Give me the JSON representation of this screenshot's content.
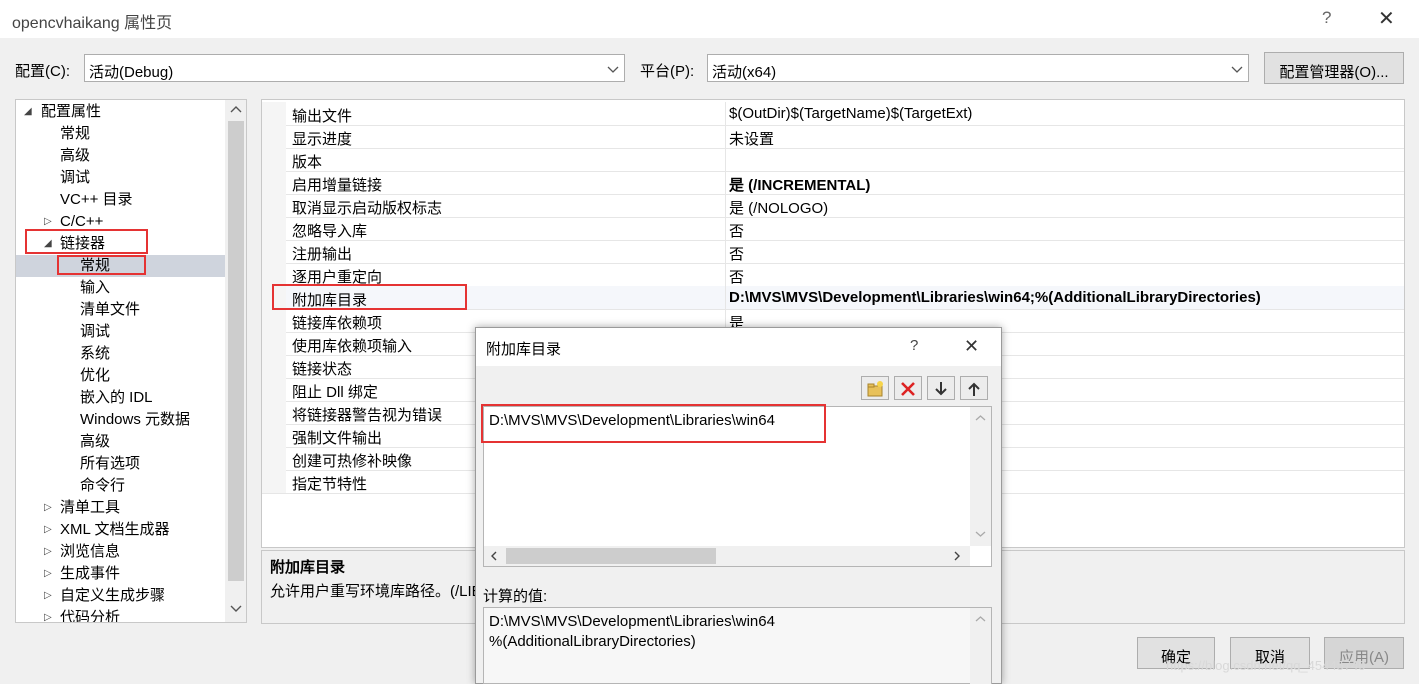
{
  "window": {
    "title": "opencvhaikang 属性页",
    "help": "?",
    "close": "✕"
  },
  "config": {
    "config_label": "配置(C):",
    "config_value": "活动(Debug)",
    "platform_label": "平台(P):",
    "platform_value": "活动(x64)",
    "manager_button": "配置管理器(O)..."
  },
  "tree": {
    "root": "配置属性",
    "items": [
      "常规",
      "高级",
      "调试",
      "VC++ 目录",
      "C/C++",
      "链接器",
      "常规",
      "输入",
      "清单文件",
      "调试",
      "系统",
      "优化",
      "嵌入的 IDL",
      "Windows 元数据",
      "高级",
      "所有选项",
      "命令行",
      "清单工具",
      "XML 文档生成器",
      "浏览信息",
      "生成事件",
      "自定义生成步骤",
      "代码分析"
    ]
  },
  "grid": {
    "rows": [
      {
        "name": "输出文件",
        "value": "$(OutDir)$(TargetName)$(TargetExt)"
      },
      {
        "name": "显示进度",
        "value": "未设置"
      },
      {
        "name": "版本",
        "value": ""
      },
      {
        "name": "启用增量链接",
        "value": "是 (/INCREMENTAL)"
      },
      {
        "name": "取消显示启动版权标志",
        "value": "是 (/NOLOGO)"
      },
      {
        "name": "忽略导入库",
        "value": "否"
      },
      {
        "name": "注册输出",
        "value": "否"
      },
      {
        "name": "逐用户重定向",
        "value": "否"
      },
      {
        "name": "附加库目录",
        "value": "D:\\MVS\\MVS\\Development\\Libraries\\win64;%(AdditionalLibraryDirectories)"
      },
      {
        "name": "链接库依赖项",
        "value": "是"
      },
      {
        "name": "使用库依赖项输入",
        "value": ""
      },
      {
        "name": "链接状态",
        "value": ""
      },
      {
        "name": "阻止 Dll 绑定",
        "value": ""
      },
      {
        "name": "将链接器警告视为错误",
        "value": ""
      },
      {
        "name": "强制文件输出",
        "value": ""
      },
      {
        "name": "创建可热修补映像",
        "value": ""
      },
      {
        "name": "指定节特性",
        "value": ""
      }
    ]
  },
  "description": {
    "title": "附加库目录",
    "text": "允许用户重写环境库路径。(/LIB"
  },
  "buttons": {
    "ok": "确定",
    "cancel": "取消",
    "apply": "应用(A)"
  },
  "watermark": "https://blog.csdn.net/qq_45445740",
  "dialog": {
    "title": "附加库目录",
    "help": "?",
    "close": "✕",
    "entry": "D:\\MVS\\MVS\\Development\\Libraries\\win64",
    "computed_label": "计算的值:",
    "computed_lines": [
      "D:\\MVS\\MVS\\Development\\Libraries\\win64",
      "%(AdditionalLibraryDirectories)"
    ],
    "toolbar": [
      "new-line-icon",
      "delete-icon",
      "move-down-icon",
      "move-up-icon"
    ]
  },
  "colors": {
    "highlight_red": "#e53333",
    "selection": "#cfd4dd"
  }
}
